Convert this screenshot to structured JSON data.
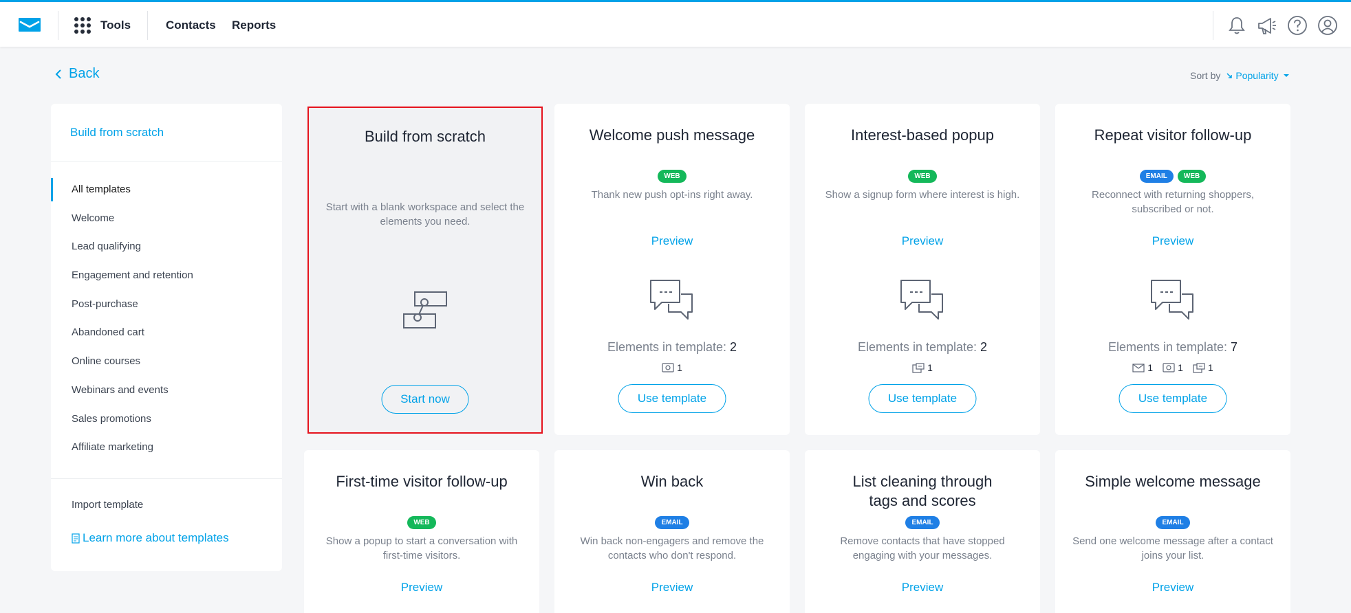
{
  "topbar": {
    "tools_label": "Tools",
    "nav": [
      "Contacts",
      "Reports"
    ],
    "icons": [
      "bell-icon",
      "megaphone-icon",
      "help-icon",
      "account-icon"
    ]
  },
  "back_label": "Back",
  "sort": {
    "label": "Sort by",
    "value": "Popularity"
  },
  "sidebar": {
    "build_label": "Build from scratch",
    "items": [
      "All templates",
      "Welcome",
      "Lead qualifying",
      "Engagement and retention",
      "Post-purchase",
      "Abandoned cart",
      "Online courses",
      "Webinars and events",
      "Sales promotions",
      "Affiliate marketing"
    ],
    "active_index": 0,
    "import_label": "Import template",
    "learn_label": "Learn more about templates"
  },
  "scratch_card": {
    "title": "Build from scratch",
    "desc": "Start with a blank workspace and select the elements you need.",
    "button": "Start now"
  },
  "labels": {
    "preview": "Preview",
    "use_template": "Use template",
    "elements_prefix": "Elements in template:"
  },
  "cards": [
    {
      "title": "Welcome push message",
      "badges": [
        "WEB"
      ],
      "desc": "Thank new push opt-ins right away.",
      "elements": "2",
      "counts": [
        {
          "icon": "push-icon",
          "n": "1"
        }
      ]
    },
    {
      "title": "Interest-based popup",
      "badges": [
        "WEB"
      ],
      "desc": "Show a signup form where interest is high.",
      "elements": "2",
      "counts": [
        {
          "icon": "popup-icon",
          "n": "1"
        }
      ]
    },
    {
      "title": "Repeat visitor follow-up",
      "badges": [
        "EMAIL",
        "WEB"
      ],
      "desc": "Reconnect with returning shoppers, subscribed or not.",
      "elements": "7",
      "counts": [
        {
          "icon": "email-icon",
          "n": "1"
        },
        {
          "icon": "push-icon",
          "n": "1"
        },
        {
          "icon": "popup-icon",
          "n": "1"
        }
      ]
    },
    {
      "title": "First-time visitor follow-up",
      "badges": [
        "WEB"
      ],
      "desc": "Show a popup to start a conversation with first-time visitors."
    },
    {
      "title": "Win back",
      "badges": [
        "EMAIL"
      ],
      "desc": "Win back non-engagers and remove the contacts who don't respond."
    },
    {
      "title": "List cleaning through tags and scores",
      "badges": [
        "EMAIL"
      ],
      "desc": "Remove contacts that have stopped engaging with your messages."
    },
    {
      "title": "Simple welcome message",
      "badges": [
        "EMAIL"
      ],
      "desc": "Send one welcome message after a contact joins your list."
    }
  ],
  "colors": {
    "accent": "#00a2e8",
    "web_badge": "#14b85a",
    "email_badge": "#1f7fe5",
    "highlight": "#e5131d"
  }
}
